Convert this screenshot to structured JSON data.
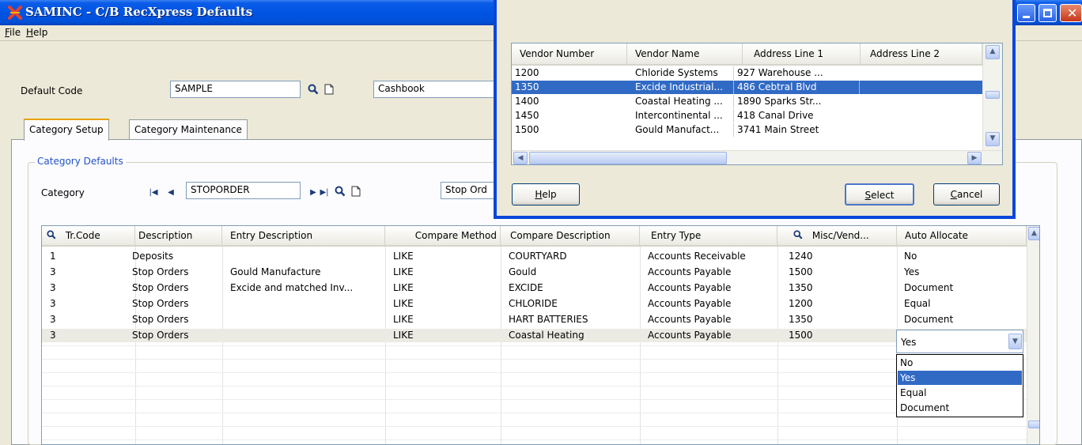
{
  "window": {
    "title": "SAMINC - C/B RecXpress Defaults"
  },
  "menu": [
    {
      "key": "F",
      "rest": "ile"
    },
    {
      "key": "H",
      "rest": "elp"
    }
  ],
  "default_code": {
    "label": "Default Code",
    "value": "SAMPLE",
    "description": "Cashbook"
  },
  "tabs": [
    "Category Setup",
    "Category Maintenance"
  ],
  "group": {
    "label": "Category Defaults"
  },
  "category": {
    "label": "Category",
    "value": "STOPORDER",
    "description": "Stop Ord"
  },
  "grid": {
    "columns": [
      "Tr.Code",
      "Description",
      "Entry Description",
      "Compare Method",
      "Compare Description",
      "Entry Type",
      "Misc/Vend...",
      "Auto Allocate"
    ],
    "rows": [
      [
        "1",
        "Deposits",
        "",
        "LIKE",
        "COURTYARD",
        "Accounts Receivable",
        "1240",
        "No"
      ],
      [
        "3",
        "Stop Orders",
        "Gould Manufacture",
        "LIKE",
        "Gould",
        "Accounts Payable",
        "1500",
        "Yes"
      ],
      [
        "3",
        "Stop Orders",
        "Excide and matched Inv...",
        "LIKE",
        "EXCIDE",
        "Accounts Payable",
        "1350",
        "Document"
      ],
      [
        "3",
        "Stop Orders",
        "",
        "LIKE",
        "CHLORIDE",
        "Accounts Payable",
        "1200",
        "Equal"
      ],
      [
        "3",
        "Stop Orders",
        "",
        "LIKE",
        "HART BATTERIES",
        "Accounts Payable",
        "1350",
        "Document"
      ],
      [
        "3",
        "Stop Orders",
        "",
        "LIKE",
        "Coastal Heating",
        "Accounts Payable",
        "1500",
        ""
      ]
    ]
  },
  "auto_allocate_dropdown": {
    "selected": "Yes",
    "options": [
      "No",
      "Yes",
      "Equal",
      "Document"
    ]
  },
  "vendor_lookup": {
    "columns": [
      "Vendor Number",
      "Vendor Name",
      "Address Line 1",
      "Address Line 2"
    ],
    "rows": [
      [
        "1200",
        "Chloride Systems",
        "927 Warehouse ..."
      ],
      [
        "1350",
        "Excide Industrial...",
        "486 Cebtral Blvd"
      ],
      [
        "1400",
        "Coastal Heating ...",
        "1890 Sparks Str..."
      ],
      [
        "1450",
        "Intercontinental ...",
        "418 Canal Drive"
      ],
      [
        "1500",
        "Gould Manufact...",
        "3741 Main Street"
      ]
    ],
    "buttons": {
      "help": {
        "key": "H",
        "rest": "elp"
      },
      "select": {
        "key": "S",
        "rest": "elect"
      },
      "cancel": {
        "key": "C",
        "rest": "ancel"
      }
    }
  },
  "colors": {
    "selection": "#316ac5",
    "titlebar": "#0054e3",
    "face": "#ece9d8"
  }
}
